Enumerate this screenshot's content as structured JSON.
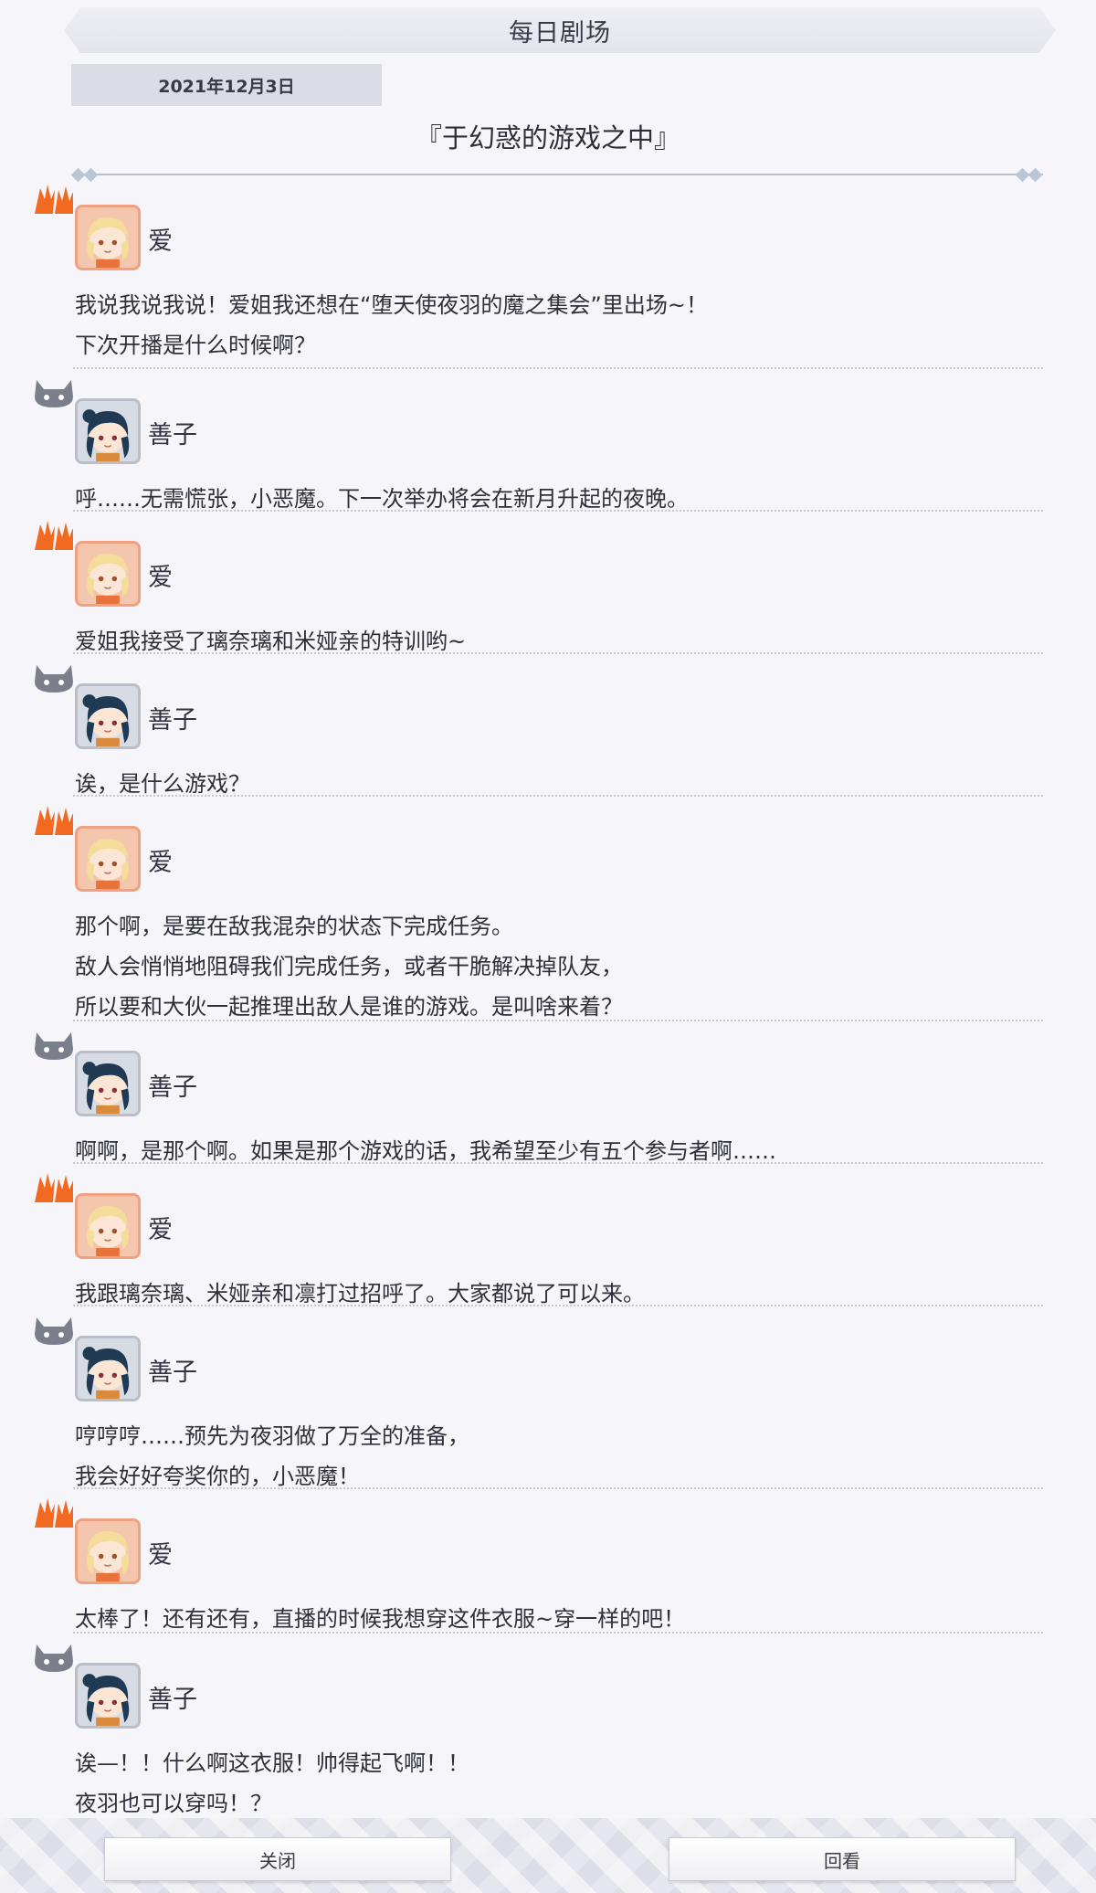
{
  "header": {
    "title": "每日剧场"
  },
  "date": "2021年12月3日",
  "episode_title": "『于幻惑的游戏之中』",
  "colors": {
    "ai_icon": "#f26a21",
    "yoshiko_icon": "#7b7f8c",
    "background": "#f6f6fa"
  },
  "entries": [
    {
      "speaker": "爱",
      "lines": [
        "我说我说我说！爱姐我还想在“堕天使夜羽的魔之集会”里出场~！",
        "下次开播是什么时候啊？"
      ]
    },
    {
      "speaker": "善子",
      "lines": [
        "呼……无需慌张，小恶魔。下一次举办将会在新月升起的夜晚。"
      ]
    },
    {
      "speaker": "爱",
      "lines": [
        "爱姐我接受了璃奈璃和米娅亲的特训哟~"
      ]
    },
    {
      "speaker": "善子",
      "lines": [
        "诶，是什么游戏？"
      ]
    },
    {
      "speaker": "爱",
      "lines": [
        "那个啊，是要在敌我混杂的状态下完成任务。",
        "敌人会悄悄地阻碍我们完成任务，或者干脆解决掉队友，",
        "所以要和大伙一起推理出敌人是谁的游戏。是叫啥来着？"
      ]
    },
    {
      "speaker": "善子",
      "lines": [
        "啊啊，是那个啊。如果是那个游戏的话，我希望至少有五个参与者啊……"
      ]
    },
    {
      "speaker": "爱",
      "lines": [
        "我跟璃奈璃、米娅亲和凛打过招呼了。大家都说了可以来。"
      ]
    },
    {
      "speaker": "善子",
      "lines": [
        "哼哼哼……预先为夜羽做了万全的准备，",
        "我会好好夸奖你的，小恶魔！"
      ]
    },
    {
      "speaker": "爱",
      "lines": [
        "太棒了！还有还有，直播的时候我想穿这件衣服~穿一样的吧！"
      ]
    },
    {
      "speaker": "善子",
      "lines": [
        "诶—！！什么啊这衣服！帅得起飞啊！！",
        "夜羽也可以穿吗！？"
      ]
    }
  ],
  "buttons": {
    "close": "关闭",
    "replay": "回看"
  }
}
